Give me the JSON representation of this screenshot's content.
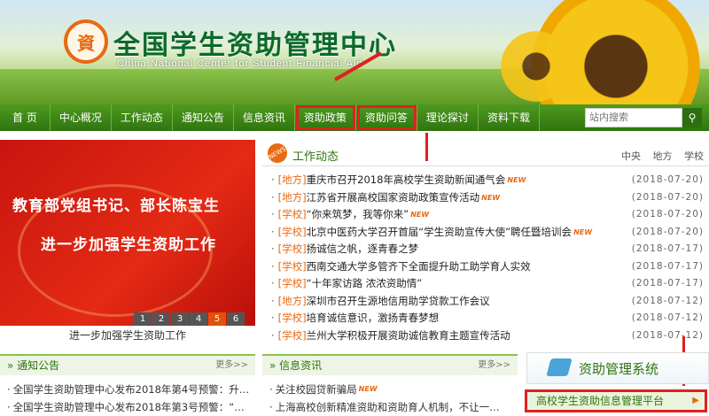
{
  "header": {
    "logo_text": "資",
    "title": "全国学生资助管理中心",
    "subtitle": "China National Center for Student Financial Aid"
  },
  "nav": {
    "items": [
      "首 页",
      "中心概况",
      "工作动态",
      "通知公告",
      "信息资讯",
      "资助政策",
      "资助问答",
      "理论探讨",
      "资料下载"
    ],
    "search_placeholder": "站内搜索",
    "search_icon": "search-icon"
  },
  "carousel": {
    "line1": "教育部党组书记、部长陈宝生",
    "line2": "进一步加强学生资助工作",
    "pages": [
      "1",
      "2",
      "3",
      "4",
      "5",
      "6"
    ],
    "active_page": "5",
    "caption": "进一步加强学生资助工作"
  },
  "news": {
    "badge": "NEWS",
    "title": "工作动态",
    "tabs": [
      "中央",
      "地方",
      "学校"
    ],
    "items": [
      {
        "cat": "[地方]",
        "title": "重庆市召开2018年高校学生资助新闻通气会",
        "new": true,
        "date": "(2018-07-20)"
      },
      {
        "cat": "[地方]",
        "title": "江苏省开展高校国家资助政策宣传活动",
        "new": true,
        "date": "(2018-07-20)"
      },
      {
        "cat": "[学校]",
        "title": "“你来筑梦，我等你来”",
        "new": true,
        "date": "(2018-07-20)"
      },
      {
        "cat": "[学校]",
        "title": "北京中医药大学召开首届“学生资助宣传大使”聘任暨培训会",
        "new": true,
        "date": "(2018-07-20)"
      },
      {
        "cat": "[学校]",
        "title": "扬诚信之帆，逐青春之梦",
        "new": false,
        "date": "(2018-07-17)"
      },
      {
        "cat": "[学校]",
        "title": "西南交通大学多管齐下全面提升助工助学育人实效",
        "new": false,
        "date": "(2018-07-17)"
      },
      {
        "cat": "[学校]",
        "title": "“十年家访路 浓浓资助情”",
        "new": false,
        "date": "(2018-07-17)"
      },
      {
        "cat": "[地方]",
        "title": "深圳市召开生源地信用助学贷款工作会议",
        "new": false,
        "date": "(2018-07-12)"
      },
      {
        "cat": "[学校]",
        "title": "培育诚信意识，激扬青春梦想",
        "new": false,
        "date": "(2018-07-12)"
      },
      {
        "cat": "[学校]",
        "title": "兰州大学积极开展资助诚信教育主题宣传活动",
        "new": false,
        "date": "(2018-07-12)"
      }
    ]
  },
  "notices": {
    "title": "通知公告",
    "more": "更多>>",
    "items": [
      "全国学生资助管理中心发布2018年第4号预警：升…",
      "全国学生资助管理中心发布2018年第3号预警：“…"
    ]
  },
  "info": {
    "title": "信息资讯",
    "more": "更多>>",
    "items": [
      {
        "text": "关注校园贷新骗局",
        "new": true
      },
      {
        "text": "上海高校创新精准资助和资助育人机制，不让一…",
        "new": false
      }
    ]
  },
  "system": {
    "title": "资助管理系统",
    "platform": "高校学生资助信息管理平台"
  },
  "colors": {
    "nav_green": "#2f7410",
    "accent_orange": "#e86a12",
    "highlight_red": "#e02020"
  }
}
